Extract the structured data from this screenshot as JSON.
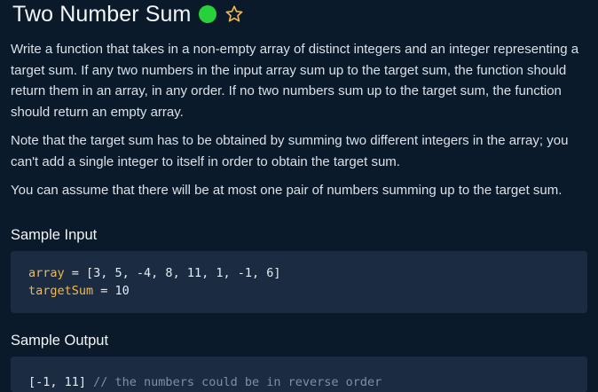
{
  "problem": {
    "title": "Two Number Sum",
    "status_icon": "green-circle",
    "favorite_icon": "star-outline",
    "description": [
      "Write a function that takes in a non-empty array of distinct integers and an integer representing a target sum. If any two numbers in the input array sum up to the target sum, the function should return them in an array, in any order. If no two numbers sum up to the target sum, the function should return an empty array.",
      "Note that the target sum has to be obtained by summing two different integers in the array; you can't add a single integer to itself in order to obtain the target sum.",
      "You can assume that there will be at most one pair of numbers summing up to the target sum."
    ]
  },
  "sample_input": {
    "heading": "Sample Input",
    "lines": [
      {
        "name": "array",
        "op": " = ",
        "value": "[3, 5, -4, 8, 11, 1, -1, 6]"
      },
      {
        "name": "targetSum",
        "op": " = ",
        "value": "10"
      }
    ]
  },
  "sample_output": {
    "heading": "Sample Output",
    "value": "[-1, 11]",
    "comment": " // the numbers could be in reverse order"
  },
  "colors": {
    "background": "#0b1a2b",
    "code_background": "#1b2c42",
    "keyword": "#f2b94a",
    "status_green": "#27d13b",
    "star": "#f2b94a"
  }
}
